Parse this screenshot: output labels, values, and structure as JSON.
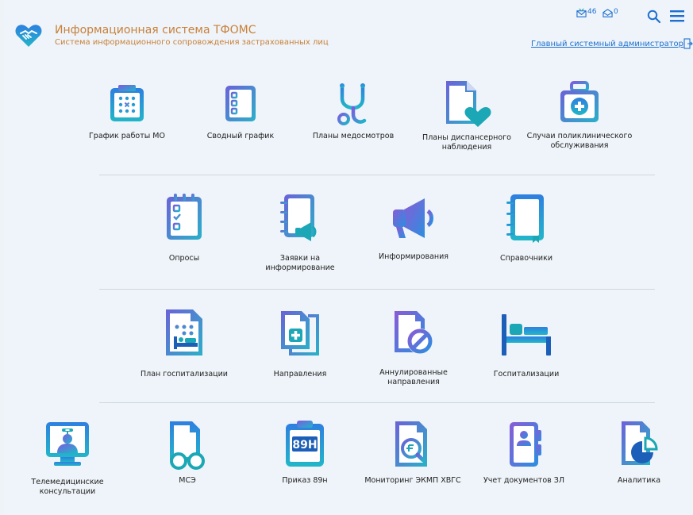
{
  "header": {
    "title": "Информационная система ТФОМС",
    "subtitle": "Система информационного сопровождения застрахованных лиц",
    "messages_count": "46",
    "mail_count": "0",
    "user": "Главный системный администратор"
  },
  "rows": [
    [
      {
        "label": "График работы МО",
        "icon": "calendar-grid-icon"
      },
      {
        "label": "Сводный график",
        "icon": "checklist-icon"
      },
      {
        "label": "Планы медосмотров",
        "icon": "stethoscope-icon"
      },
      {
        "label": "Планы диспансерного наблюдения",
        "icon": "document-heart-icon"
      },
      {
        "label": "Случаи поликлинического обслуживания",
        "icon": "medical-bag-icon"
      }
    ],
    [
      {
        "label": "Опросы",
        "icon": "survey-clipboard-icon"
      },
      {
        "label": "Заявки на информирование",
        "icon": "notebook-megaphone-icon"
      },
      {
        "label": "Информирования",
        "icon": "megaphone-icon"
      },
      {
        "label": "Справочники",
        "icon": "notebook-icon"
      }
    ],
    [
      {
        "label": "План госпитализации",
        "icon": "hospital-plan-icon"
      },
      {
        "label": "Направления",
        "icon": "referral-icon"
      },
      {
        "label": "Аннулированные направления",
        "icon": "cancelled-document-icon"
      },
      {
        "label": "Госпитализации",
        "icon": "hospital-bed-icon"
      }
    ],
    [
      {
        "label": "Телемедицинские консультации",
        "icon": "telemedicine-icon"
      },
      {
        "label": "МСЭ",
        "icon": "document-glasses-icon"
      },
      {
        "label": "Приказ 89н",
        "icon": "order-89h-icon"
      },
      {
        "label": "Мониторинг ЭКМП ХВГС",
        "icon": "document-magnifier-icon"
      },
      {
        "label": "Учет документов ЗЛ",
        "icon": "person-document-icon"
      },
      {
        "label": "Аналитика",
        "icon": "document-chart-icon"
      }
    ]
  ],
  "icon_text": {
    "order": "89H"
  },
  "colors": {
    "gradient_start": "#2f8fe0",
    "gradient_end": "#25b8c8",
    "accent_purple": "#8a5bd6",
    "title_orange": "#c9803a",
    "link_blue": "#1f6fd1"
  }
}
